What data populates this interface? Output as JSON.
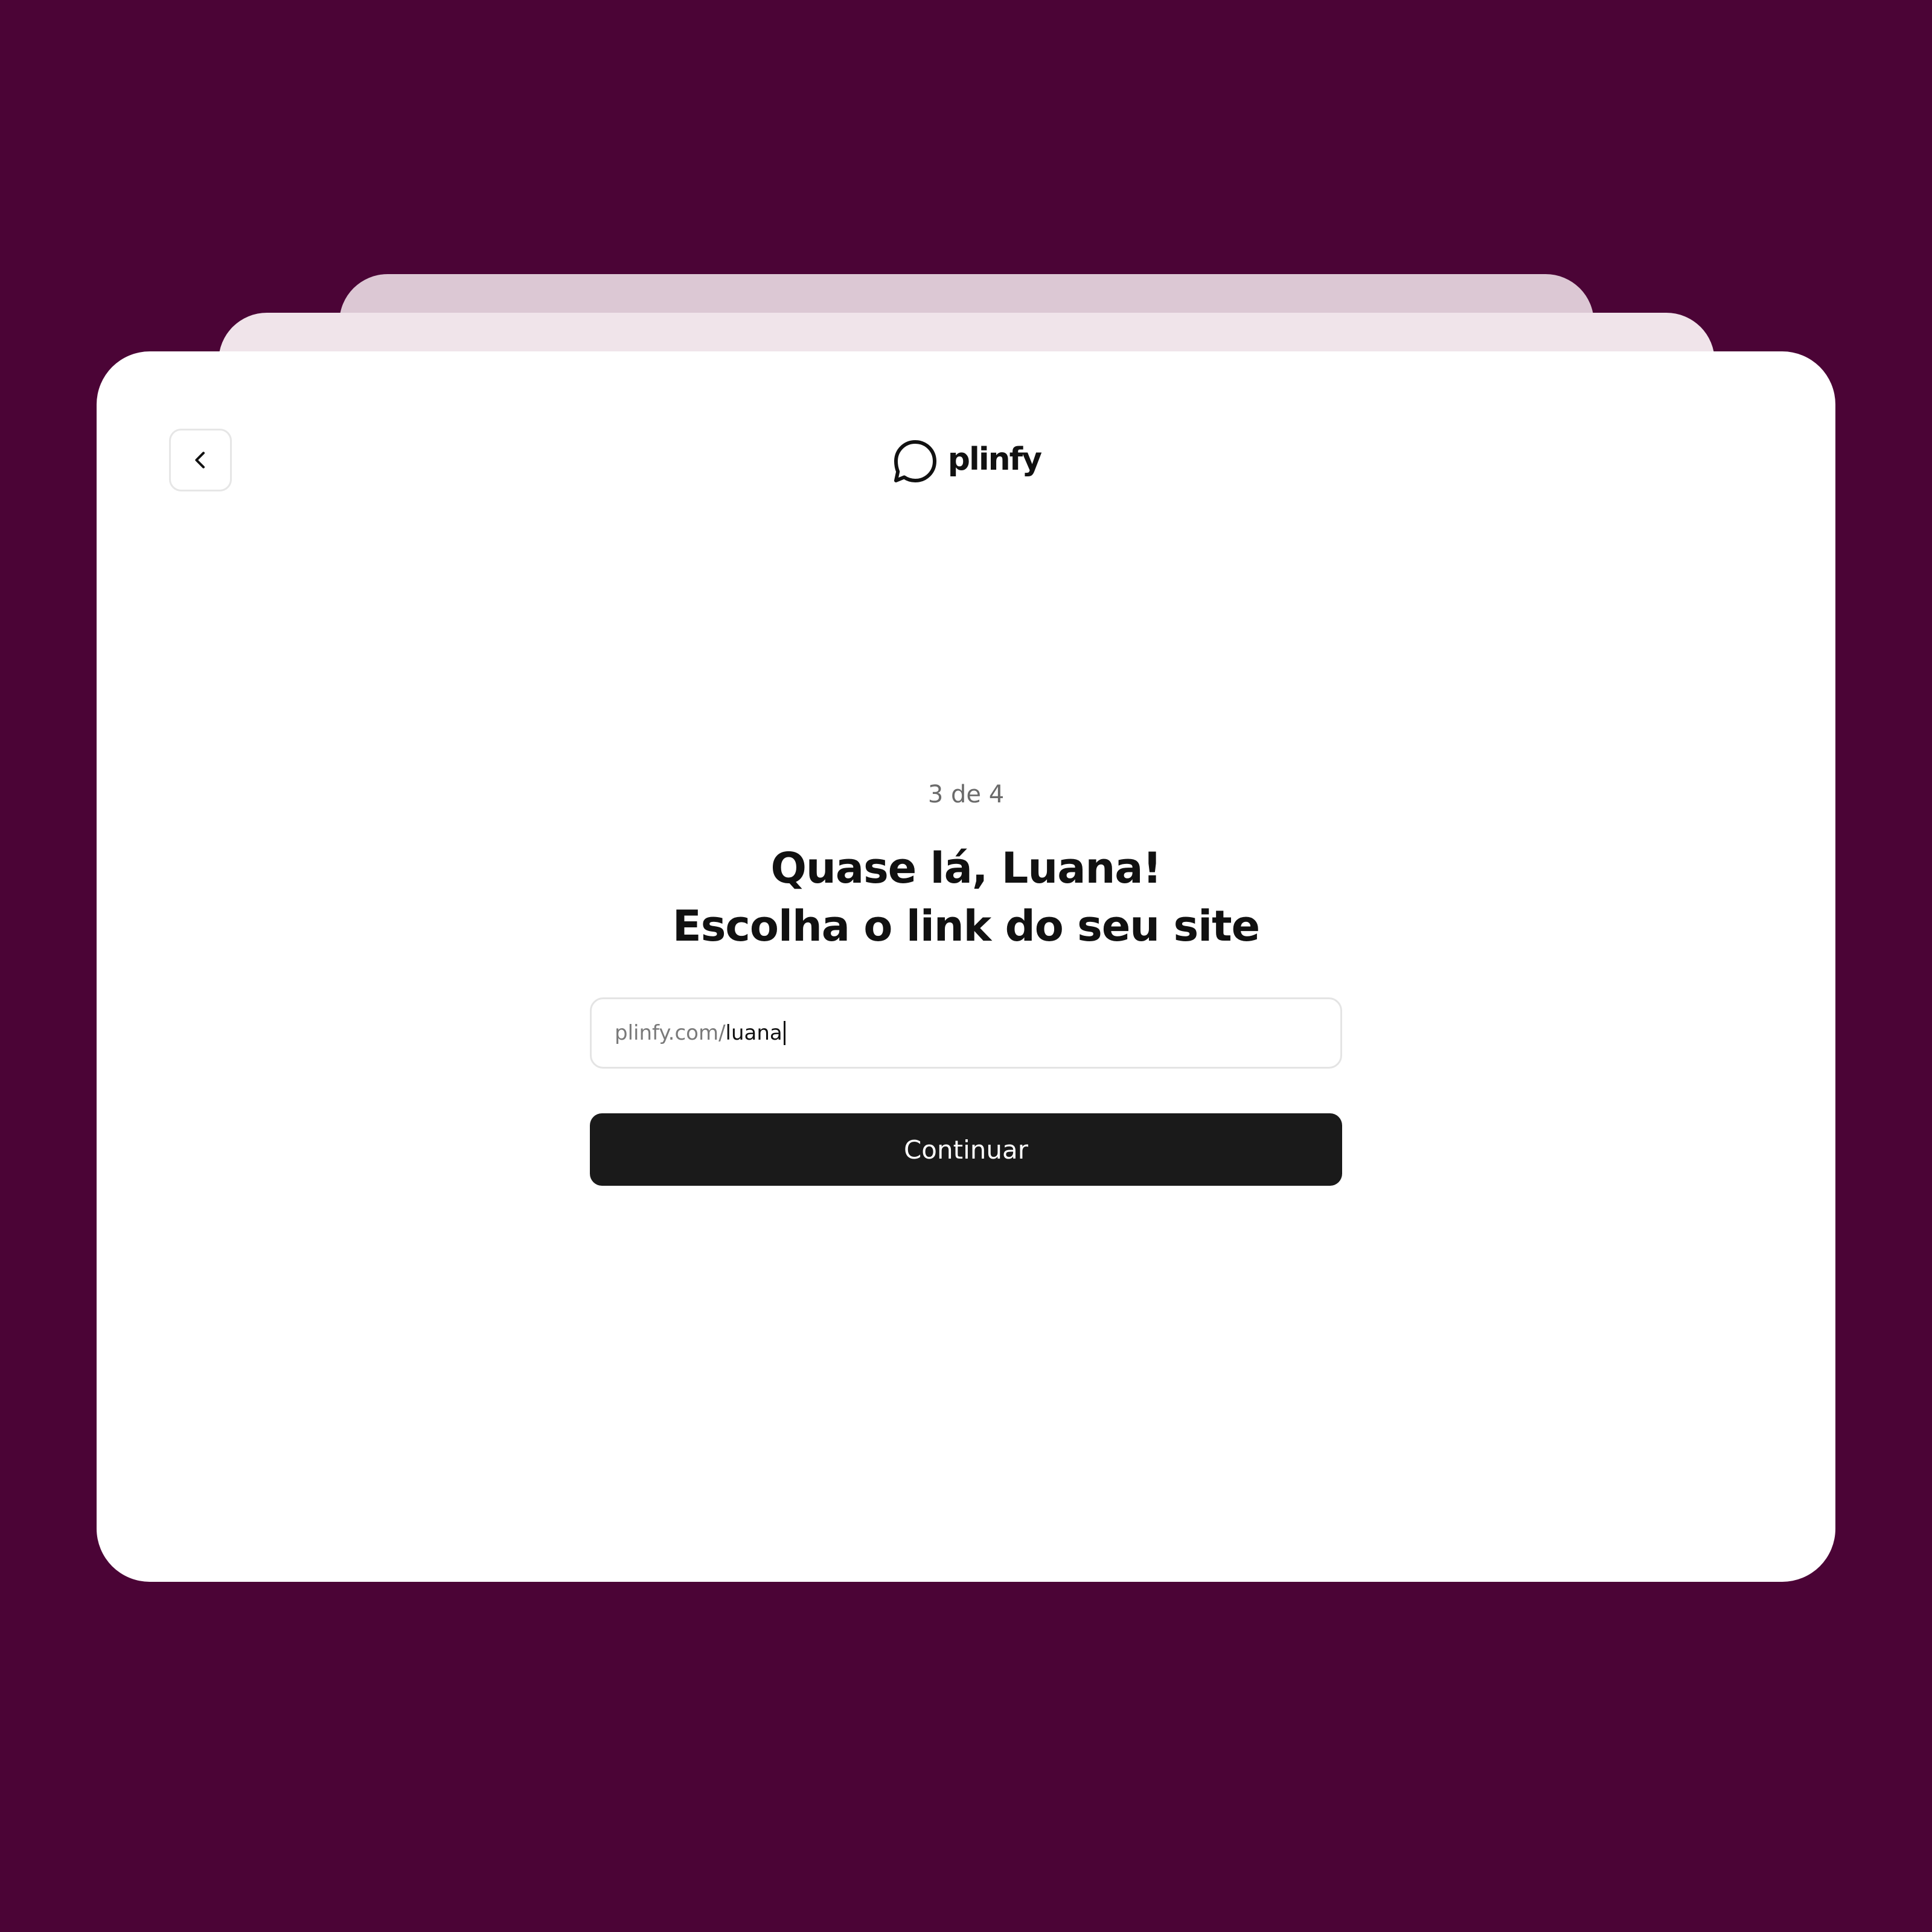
{
  "header": {
    "logo_text": "plinfy",
    "logo_icon": "speech-bubble-icon",
    "back_icon": "chevron-left-icon"
  },
  "step": {
    "label": "3 de 4"
  },
  "headline": {
    "line1": "Quase lá, Luana!",
    "line2": "Escolha o link do seu site"
  },
  "url_input": {
    "prefix": "plinfy.com/",
    "value": "luana"
  },
  "continue_button": {
    "label": "Continuar"
  },
  "colors": {
    "background": "#4b0436",
    "card": "#ffffff",
    "stack_mid": "#f0e4ea",
    "stack_back": "#dcc8d4",
    "button": "#1a1a1a",
    "text": "#111111",
    "muted": "#6b6b6b"
  }
}
